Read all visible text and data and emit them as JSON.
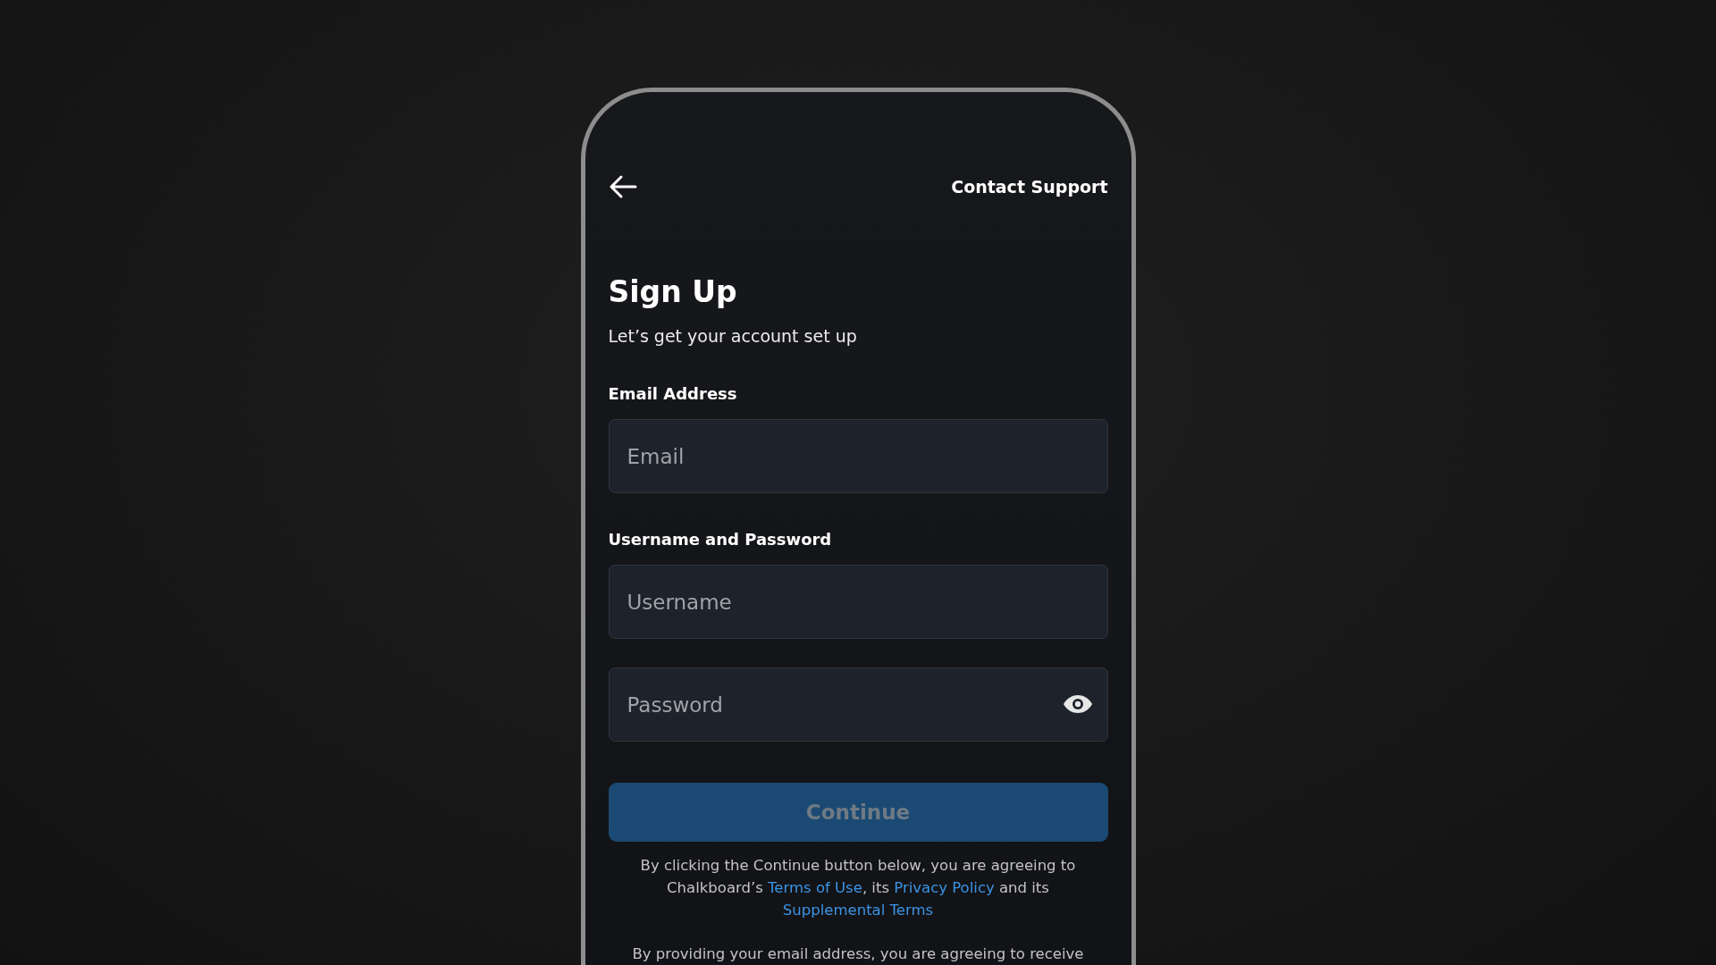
{
  "header": {
    "contact_link": "Contact Support"
  },
  "title": "Sign Up",
  "subtitle": "Let’s get your account set up",
  "sections": [
    {
      "label": "Email Address",
      "fields": [
        {
          "kind": "text",
          "placeholder": "Email"
        }
      ]
    },
    {
      "label": "Username and Password",
      "fields": [
        {
          "kind": "text",
          "placeholder": "Username"
        },
        {
          "kind": "password",
          "placeholder": "Password"
        }
      ]
    }
  ],
  "continue_button": {
    "label": "Continue",
    "disabled": true
  },
  "terms": [
    {
      "kind": "text",
      "text": "By clicking the Continue button below, you are agreeing to Chalkboard’s "
    },
    {
      "kind": "link",
      "text": "Terms of Use"
    },
    {
      "kind": "text",
      "text": ", its "
    },
    {
      "kind": "link",
      "text": "Privacy Policy"
    },
    {
      "kind": "text",
      "text": " and its "
    },
    {
      "kind": "link",
      "text": "Supplemental Terms"
    }
  ],
  "email_notice": "By providing your email address, you are agreeing to receive"
}
